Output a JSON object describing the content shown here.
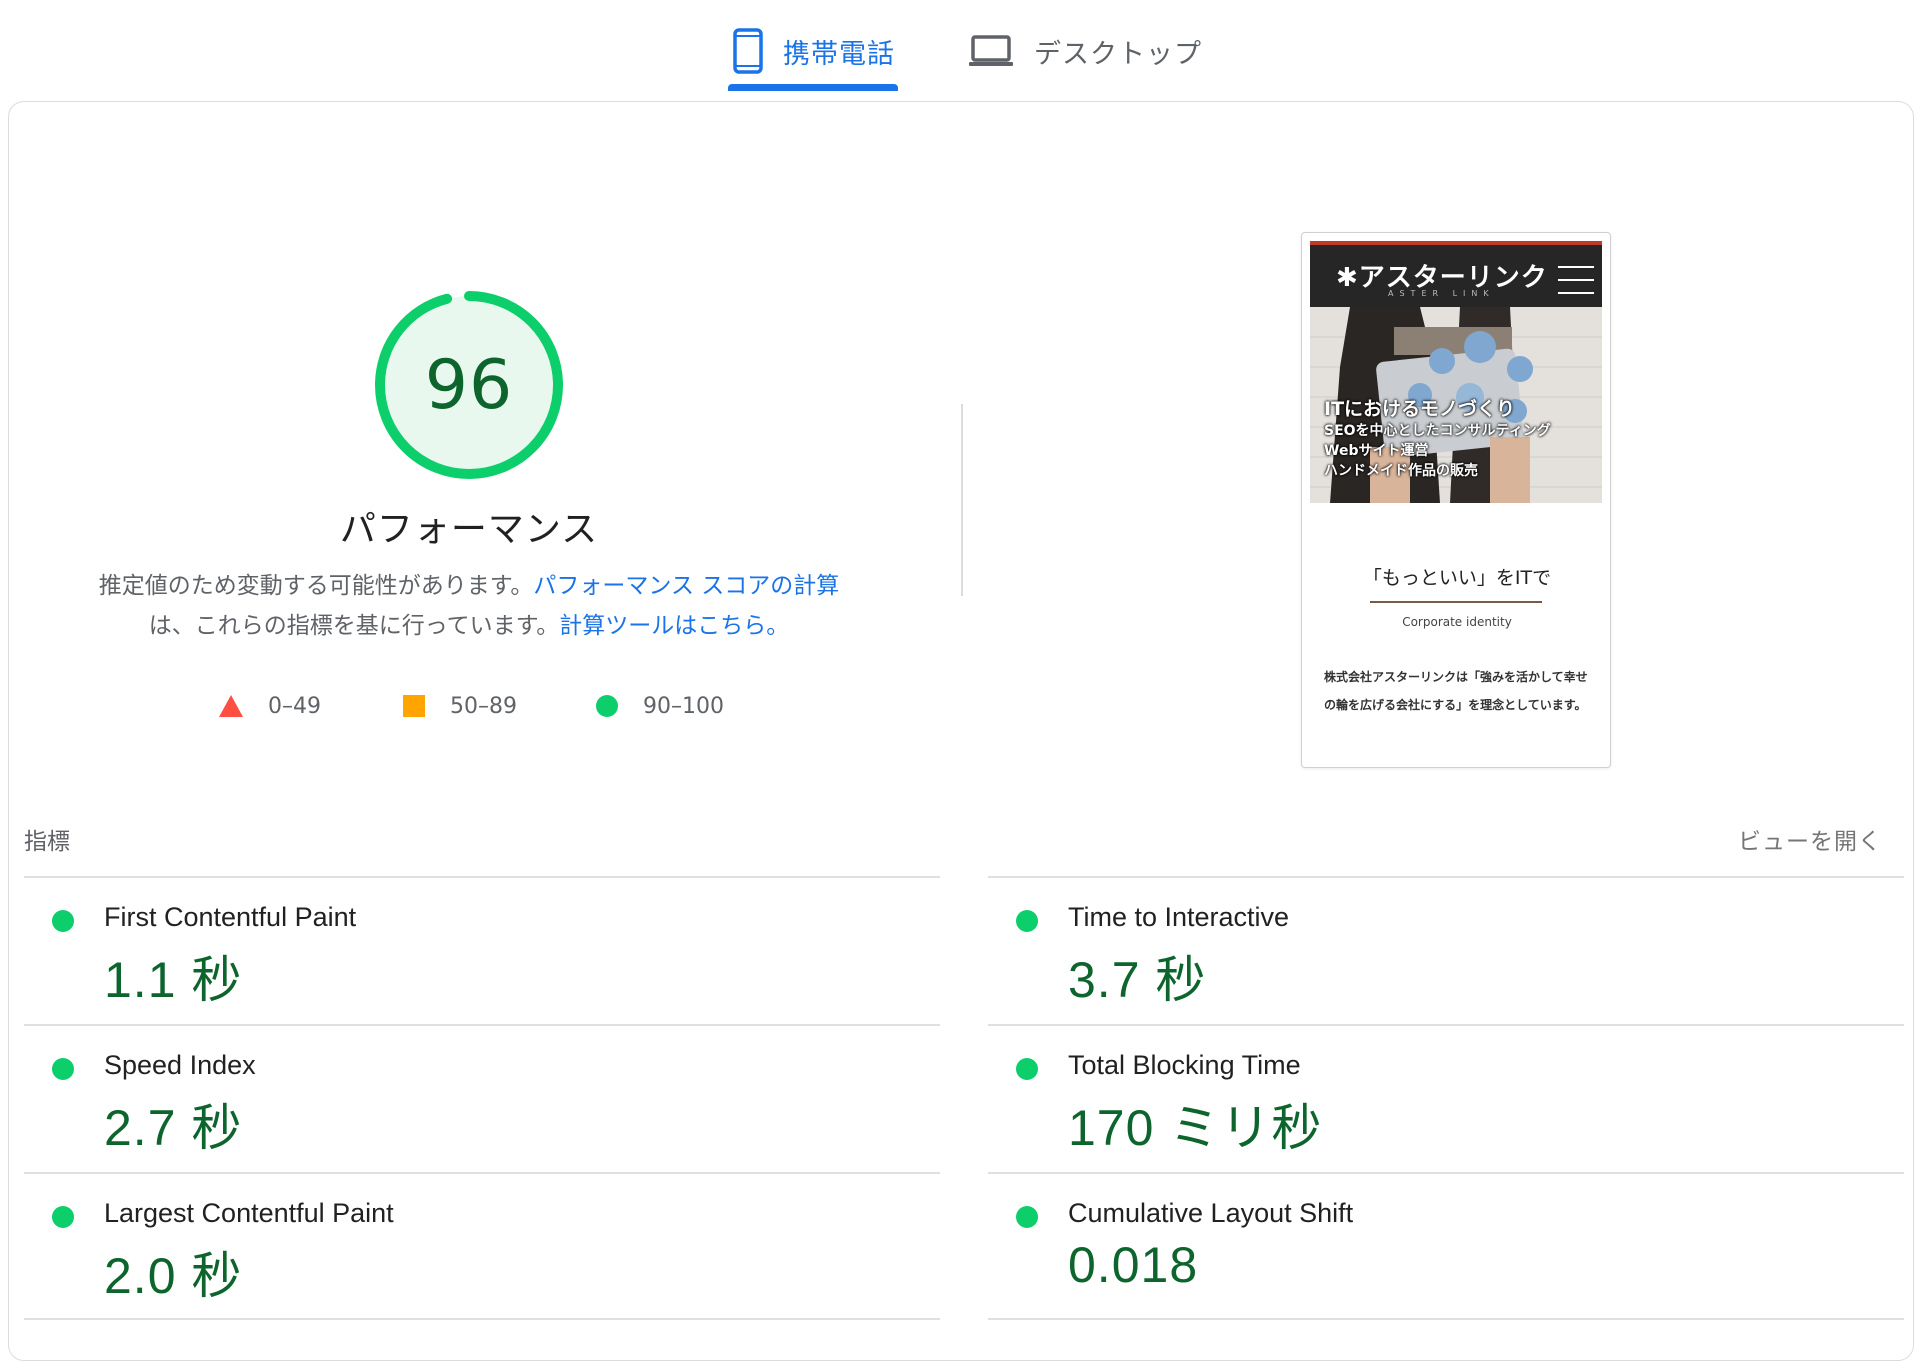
{
  "tabs": {
    "mobile_label": "携帯電話",
    "desktop_label": "デスクトップ",
    "active": "mobile"
  },
  "colors": {
    "accent": "#1a73e8",
    "pass": "#0cce6b",
    "pass_text": "#0d652d",
    "average": "#ffa400",
    "fail": "#ff4e42"
  },
  "gauge": {
    "score": "96",
    "score_value": 96,
    "title": "パフォーマンス"
  },
  "description": {
    "text_1": "推定値のため変動する可能性があります。",
    "link_1": "パフォーマンス スコアの計算",
    "text_2": "は、これらの指標を基に行っています。",
    "link_2": "計算ツールはこちら。"
  },
  "legend": {
    "fail": "0–49",
    "average": "50–89",
    "pass": "90–100"
  },
  "screenshot": {
    "logo": "アスターリンク",
    "logo_sub": "ASTER LINK",
    "hero_line1": "ITにおけるモノづくり",
    "hero_line2": "SEOを中心としたコンサルティング",
    "hero_line3": "Webサイト運営",
    "hero_line4": "ハンドメイド作品の販売",
    "tagline": "「もっといい」をITで",
    "subtitle": "Corporate identity",
    "body": "株式会社アスターリンクは「強みを活かして幸せの輪を広げる会社にする」を理念としています。"
  },
  "metrics": {
    "label": "指標",
    "expand_label": "ビューを開く",
    "items": [
      {
        "name": "First Contentful Paint",
        "value": "1.1 秒",
        "status": "pass"
      },
      {
        "name": "Time to Interactive",
        "value": "3.7 秒",
        "status": "pass"
      },
      {
        "name": "Speed Index",
        "value": "2.7 秒",
        "status": "pass"
      },
      {
        "name": "Total Blocking Time",
        "value": "170 ミリ秒",
        "status": "pass"
      },
      {
        "name": "Largest Contentful Paint",
        "value": "2.0 秒",
        "status": "pass"
      },
      {
        "name": "Cumulative Layout Shift",
        "value": "0.018",
        "status": "pass"
      }
    ]
  }
}
